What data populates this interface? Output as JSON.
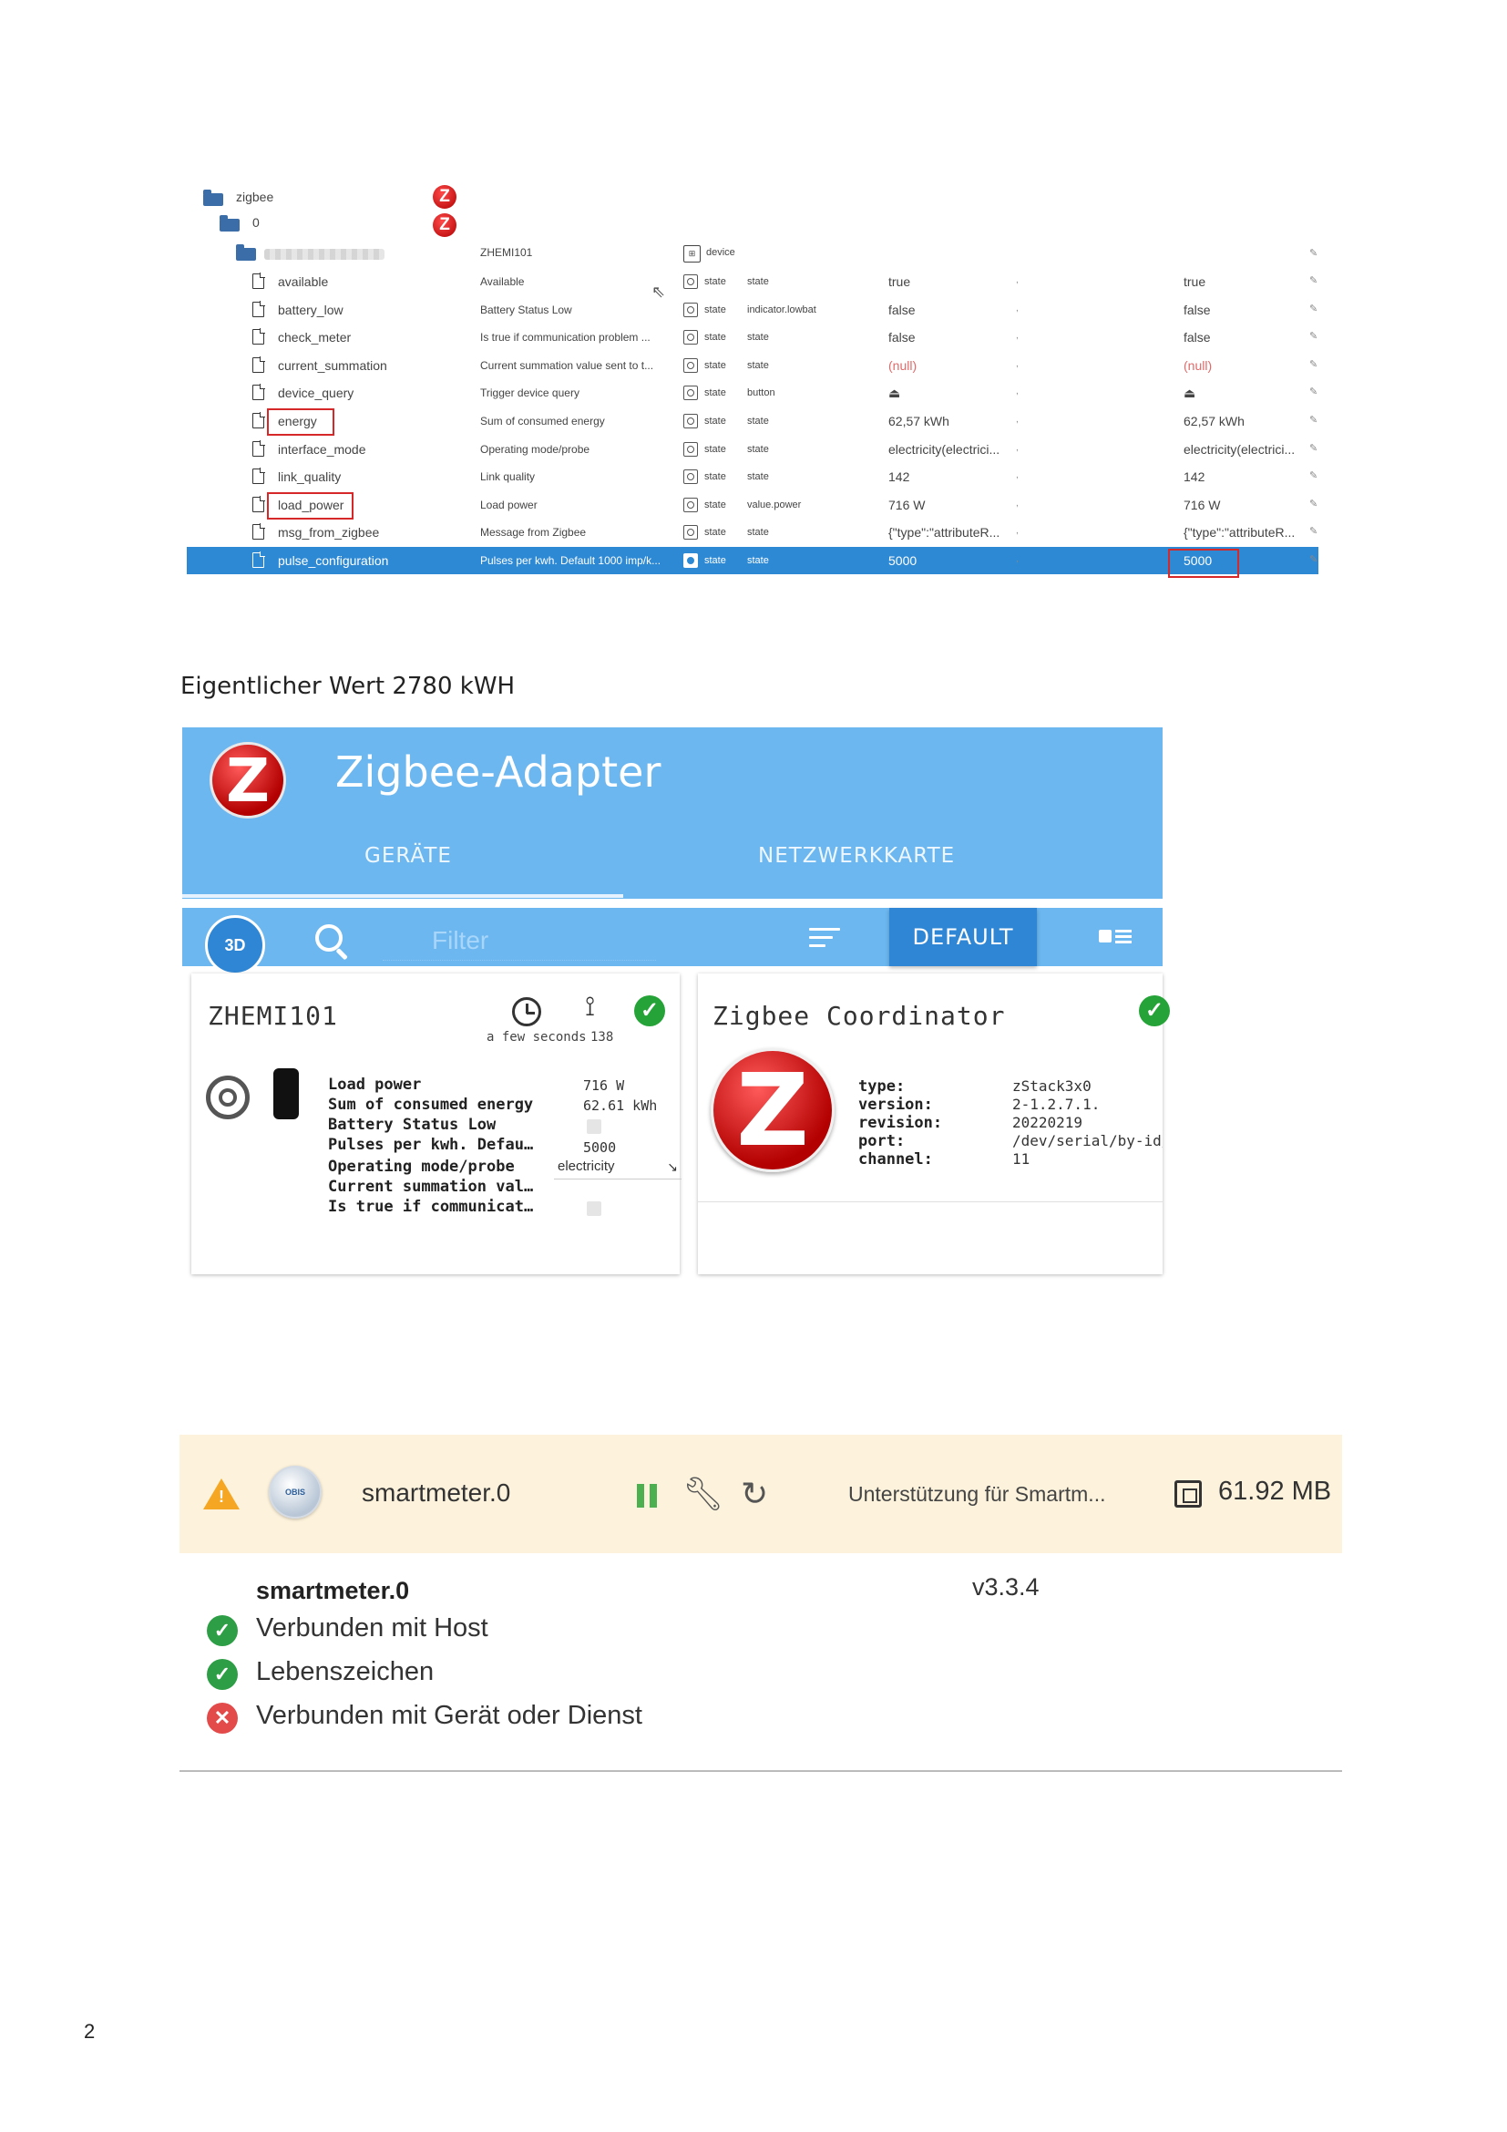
{
  "tree": {
    "root_label": "zigbee",
    "instance_label": "0",
    "device_name": "ZHEMI101",
    "device_role": "device",
    "rows": [
      {
        "name": "available",
        "desc": "Available",
        "role": "state",
        "type": "state",
        "val1": "true",
        "val2": "true"
      },
      {
        "name": "battery_low",
        "desc": "Battery Status Low",
        "role": "state",
        "type": "indicator.lowbat",
        "val1": "false",
        "val2": "false"
      },
      {
        "name": "check_meter",
        "desc": "Is true if communication problem ...",
        "role": "state",
        "type": "state",
        "val1": "false",
        "val2": "false"
      },
      {
        "name": "current_summation",
        "desc": "Current summation value sent to t...",
        "role": "state",
        "type": "state",
        "val1": "(null)",
        "val2": "(null)"
      },
      {
        "name": "device_query",
        "desc": "Trigger device query",
        "role": "state",
        "type": "button",
        "val1": "⏏",
        "val2": "⏏"
      },
      {
        "name": "energy",
        "desc": "Sum of consumed energy",
        "role": "state",
        "type": "state",
        "val1": "62,57 kWh",
        "val2": "62,57 kWh"
      },
      {
        "name": "interface_mode",
        "desc": "Operating mode/probe",
        "role": "state",
        "type": "state",
        "val1": "electricity(electrici...",
        "val2": "electricity(electrici..."
      },
      {
        "name": "link_quality",
        "desc": "Link quality",
        "role": "state",
        "type": "state",
        "val1": "142",
        "val2": "142"
      },
      {
        "name": "load_power",
        "desc": "Load power",
        "role": "state",
        "type": "value.power",
        "val1": "716 W",
        "val2": "716 W"
      },
      {
        "name": "msg_from_zigbee",
        "desc": "Message from Zigbee",
        "role": "state",
        "type": "state",
        "val1": "{\"type\":\"attributeR...",
        "val2": "{\"type\":\"attributeR..."
      },
      {
        "name": "pulse_configuration",
        "desc": "Pulses per kwh. Default 1000 imp/k...",
        "role": "state",
        "type": "state",
        "val1": "5000",
        "val2": "5000"
      }
    ]
  },
  "caption": "Eigentlicher Wert 2780 kWH",
  "adapter": {
    "title": "Zigbee-Adapter",
    "tabs": [
      "GERÄTE",
      "NETZWERKKARTE"
    ],
    "btn3d": "3D",
    "filter_placeholder": "Filter",
    "default_label": "DEFAULT",
    "device_card": {
      "title": "ZHEMI101",
      "last_seen": "a few seconds",
      "link_quality": "138",
      "labels": [
        "Load power",
        "Sum of consumed energy",
        "Battery Status Low",
        "Pulses per kwh. Default ...",
        "Operating mode/probe",
        "Current summation valu...",
        "Is true if communication..."
      ],
      "load_power": "716 W",
      "energy": "62.61 kWh",
      "pulses": "5000",
      "mode": "electricity"
    },
    "coord_card": {
      "title": "Zigbee Coordinator",
      "keys": [
        "type:",
        "version:",
        "revision:",
        "port:",
        "channel:"
      ],
      "values": [
        "zStack3x0",
        "2-1.2.7.1.",
        "20220219",
        "/dev/serial/by-id/usb",
        "11"
      ]
    }
  },
  "smartmeter": {
    "instance": "smartmeter.0",
    "logo_text": "OBIS",
    "description": "Unterstützung für Smartm...",
    "memory": "61.92 MB",
    "detail_name": "smartmeter.0",
    "version": "v3.3.4",
    "statuses": [
      {
        "text": "Verbunden mit Host",
        "ok": true
      },
      {
        "text": "Lebenszeichen",
        "ok": true
      },
      {
        "text": "Verbunden mit Gerät oder Dienst",
        "ok": false
      }
    ]
  },
  "page_number": "2"
}
